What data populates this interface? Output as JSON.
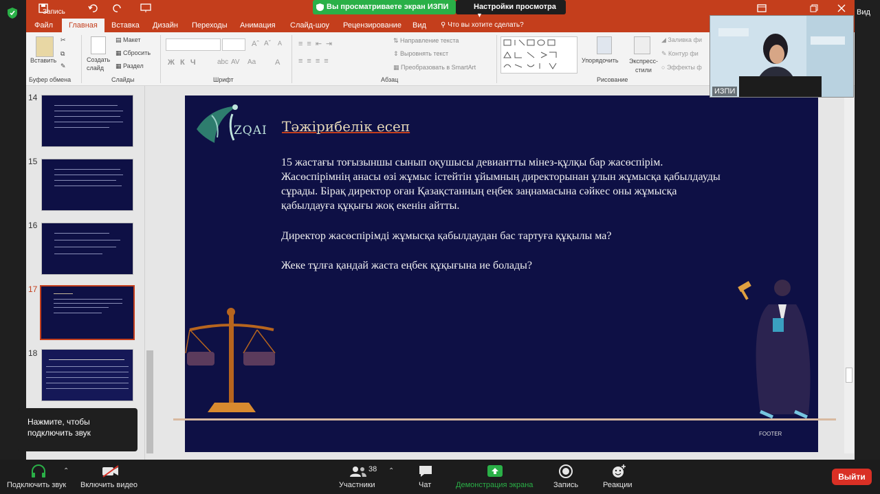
{
  "zoom": {
    "recording_label": "Запись",
    "share_banner": "Вы просматриваете экран ИЗПИ",
    "view_settings": "Настройки просмотра",
    "view_label": "Вид",
    "participant_name": "ИЗПИ",
    "participant_count": "38",
    "tooltip": [
      "Нажмите, чтобы",
      "подключить звук"
    ],
    "bottom": {
      "audio": "Подключить звук",
      "video": "Включить видео",
      "participants": "Участники",
      "chat": "Чат",
      "share": "Демонстрация экрана",
      "record": "Запись",
      "reactions": "Реакции",
      "end": "Выйти"
    }
  },
  "ppt": {
    "tabs": [
      "Файл",
      "Главная",
      "Вставка",
      "Дизайн",
      "Переходы",
      "Анимация",
      "Слайд-шоу",
      "Рецензирование",
      "Вид",
      "Что вы хотите сделать?"
    ],
    "active_tab": "Главная",
    "ribbon": {
      "paste": "Вставить",
      "clipboard": "Буфер обмена",
      "new_slide": "Создать слайд",
      "layout": "Макет",
      "reset": "Сбросить",
      "section": "Раздел",
      "slides": "Слайды",
      "font_group": "Шрифт",
      "text_direction": "Направление текста",
      "align_text": "Выровнять текст",
      "smartart": "Преобразовать в SmartArt",
      "paragraph": "Абзац",
      "arrange": "Упорядочить",
      "quick_styles": "Экспресс-стили",
      "drawing": "Рисование",
      "fill": "Заливка фи",
      "outline": "Контур фи",
      "effects": "Эффекты ф"
    },
    "thumbs": [
      "14",
      "15",
      "16",
      "17",
      "18"
    ],
    "selected_thumb": "17"
  },
  "slide": {
    "logo_text": "ZQAI",
    "title": "Тәжірибелік есеп",
    "paragraph1": "15 жастағы тоғызыншы сынып оқушысы девиантты мінез-құлқы бар жасөспірім. Жасөспірімнің анасы өзі жұмыс істейтін ұйымның директорынан ұлын жұмысқа қабылдауды сұрады. Бірақ директор оған Қазақстанның еңбек заңнамасына сәйкес оны жұмысқа қабылдауға құқығы жоқ екенін айтты.",
    "paragraph2": "Директор жасөспірімді жұмысқа қабылдаудан бас тартуға құқылы ма?",
    "paragraph3": "Жеке тұлға қандай жаста еңбек құқығына ие болады?",
    "footer": "FOOTER"
  }
}
